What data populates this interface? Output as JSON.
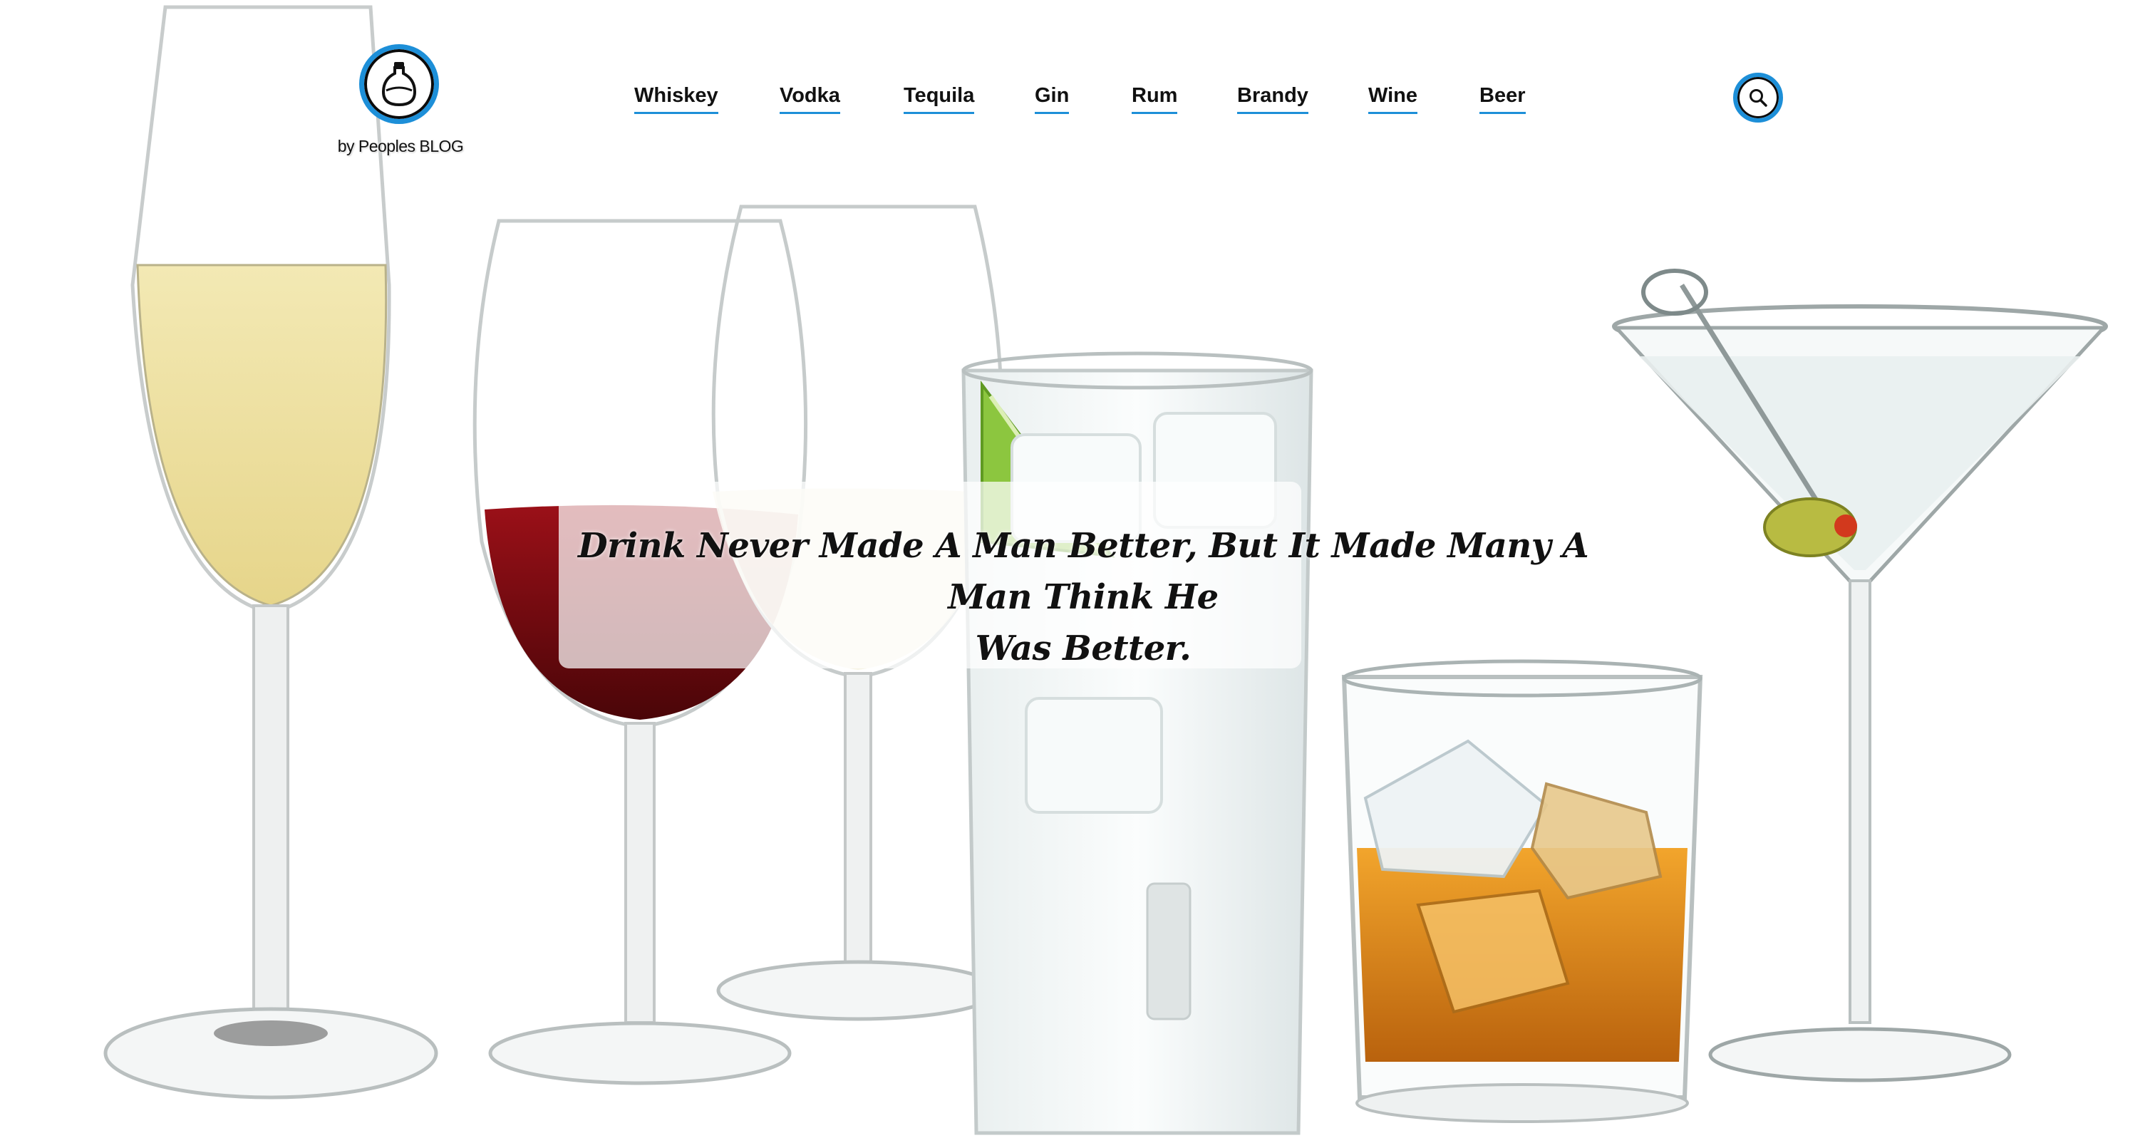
{
  "brand": {
    "logo_icon": "bottle-icon",
    "tagline": "by Peoples BLOG"
  },
  "nav": {
    "items": [
      {
        "label": "Whiskey"
      },
      {
        "label": "Vodka"
      },
      {
        "label": "Tequila"
      },
      {
        "label": "Gin"
      },
      {
        "label": "Rum"
      },
      {
        "label": "Brandy"
      },
      {
        "label": "Wine"
      },
      {
        "label": "Beer"
      }
    ]
  },
  "search": {
    "icon": "search-icon"
  },
  "hero": {
    "quote_line1": "Drink Never Made A Man Better, But It Made Many A Man Think He",
    "quote_line2": "Was Better."
  },
  "colors": {
    "accent": "#1d8fd8",
    "text": "#111111",
    "background": "#ffffff"
  }
}
